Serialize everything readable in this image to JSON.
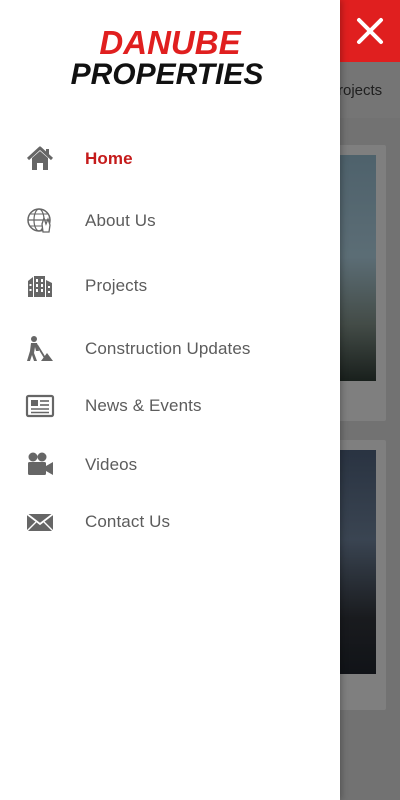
{
  "brand": {
    "line1": "DANUBE",
    "line2": "PROPERTIES",
    "accent_color": "#e01f1f"
  },
  "background": {
    "tab_fragment": "rojects"
  },
  "close_icon": "close-icon",
  "menu": {
    "items": [
      {
        "label": "Home",
        "icon": "home-icon",
        "active": true
      },
      {
        "label": "About Us",
        "icon": "globe-hand-icon",
        "active": false
      },
      {
        "label": "Projects",
        "icon": "building-icon",
        "active": false
      },
      {
        "label": "Construction Updates",
        "icon": "construction-worker-icon",
        "active": false
      },
      {
        "label": "News &  Events",
        "icon": "newspaper-icon",
        "active": false
      },
      {
        "label": "Videos",
        "icon": "video-camera-icon",
        "active": false
      },
      {
        "label": "Contact Us",
        "icon": "envelope-icon",
        "active": false
      }
    ],
    "active_color": "#c51b1b",
    "text_color": "#5c5c5c",
    "icon_color": "#666666"
  }
}
